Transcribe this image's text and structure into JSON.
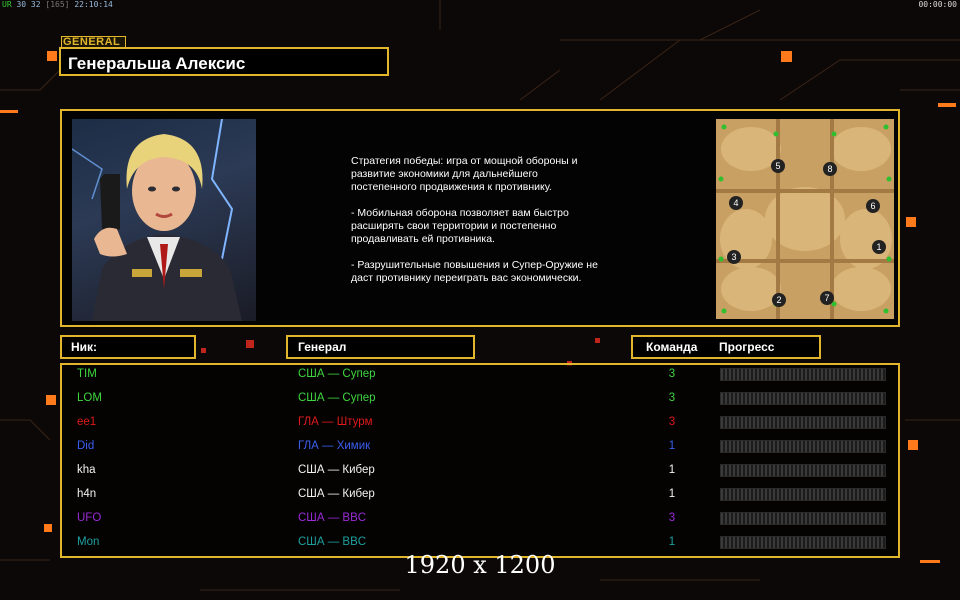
{
  "status": {
    "fps_label": "UR",
    "fps": "30 32",
    "fps_extra": "[165]",
    "clock": "22:10:14",
    "timer": "00:00:00"
  },
  "header": {
    "tag": "GENERAL",
    "title": "Генеральша Алексис"
  },
  "description": [
    "Стратегия победы: игра от мощной обороны и\n развитие экономики для дальнейшего\n постепенного продвижения к противнику.",
    "- Мобильная оборона позволяет вам быстро\n расширять свои территории и постепенно\n продавливать ей противника.",
    "- Разрушительные повышения и Супер-Оружие не\n даст противнику переиграть вас экономически."
  ],
  "map": {
    "start_positions": [
      "1",
      "2",
      "3",
      "4",
      "5",
      "6",
      "7",
      "8"
    ]
  },
  "columns": {
    "nick": "Ник:",
    "general": "Генерал",
    "team": "Команда",
    "progress": "Прогресс"
  },
  "players": [
    {
      "nick": "TIM",
      "general": "США — Супер",
      "team": "3",
      "color": "#3fd63f"
    },
    {
      "nick": "LOM",
      "general": "США — Супер",
      "team": "3",
      "color": "#3fd63f"
    },
    {
      "nick": "ee1",
      "general": "ГЛА — Штурм",
      "team": "3",
      "color": "#e01b1b"
    },
    {
      "nick": "Did",
      "general": "ГЛА — Химик",
      "team": "1",
      "color": "#3a5ff0"
    },
    {
      "nick": "kha",
      "general": "США — Кибер",
      "team": "1",
      "color": "#f2f2f2"
    },
    {
      "nick": "h4n",
      "general": "США — Кибер",
      "team": "1",
      "color": "#f2f2f2"
    },
    {
      "nick": "UFO",
      "general": "США — BBC",
      "team": "3",
      "color": "#9a2bd6"
    },
    {
      "nick": "Mon",
      "general": "США — BBC",
      "team": "1",
      "color": "#1fa0a0"
    }
  ],
  "resolution": "1920 x 1200",
  "colors": {
    "frame": "#e1b52c",
    "accent_orange": "#ff7a1a"
  }
}
